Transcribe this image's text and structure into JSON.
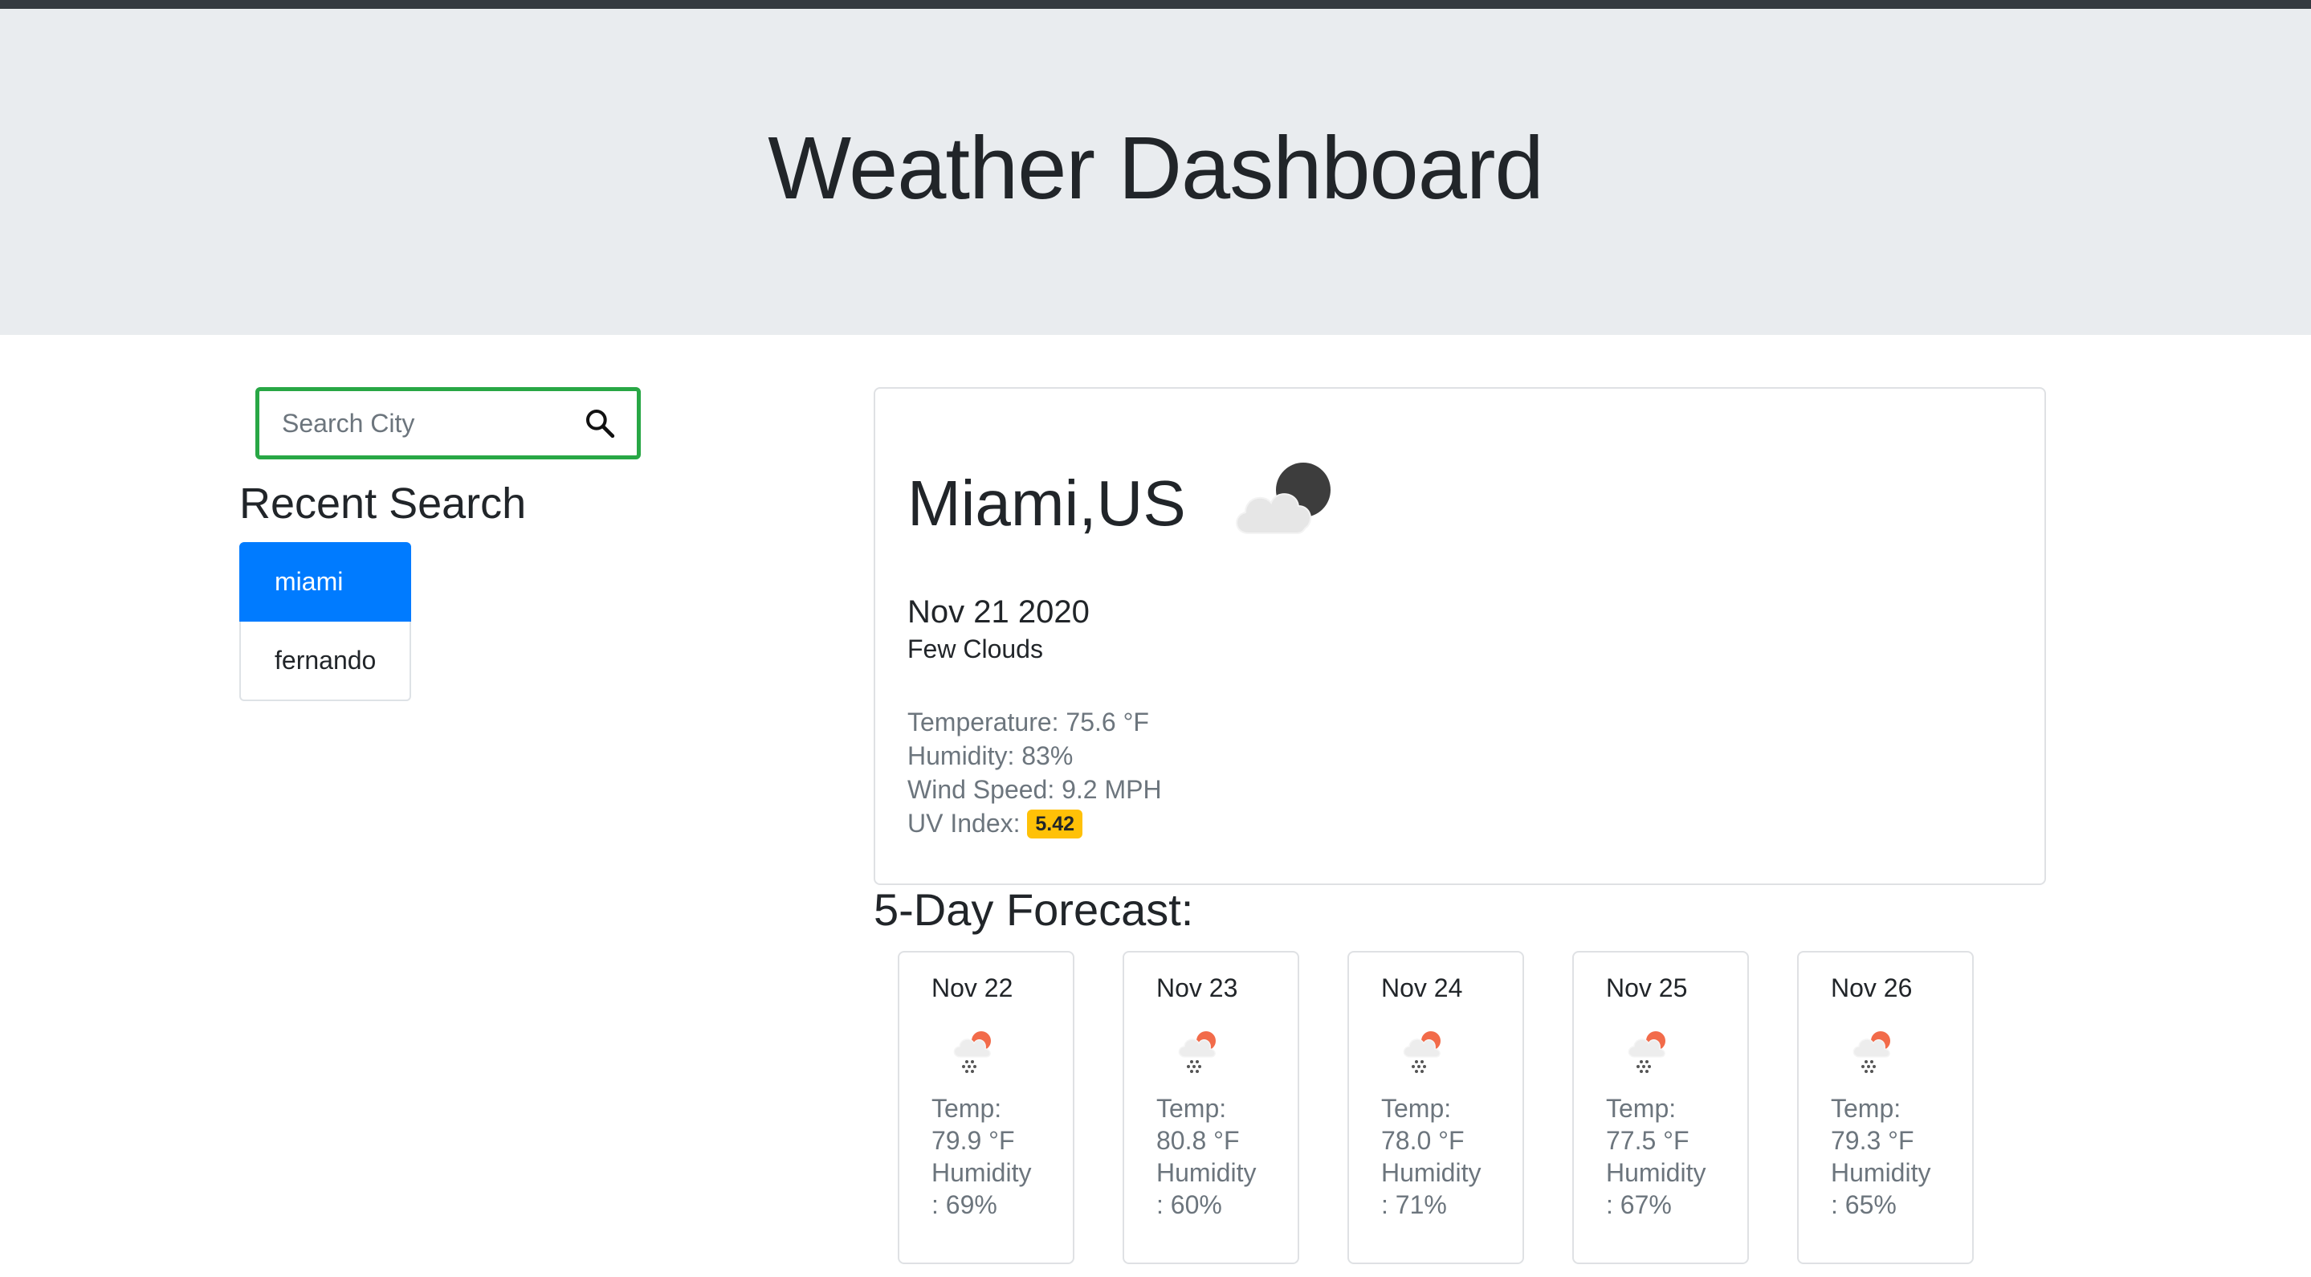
{
  "header": {
    "title": "Weather Dashboard"
  },
  "search": {
    "placeholder": "Search City",
    "value": ""
  },
  "recent": {
    "title": "Recent Search",
    "items": [
      {
        "label": "miami",
        "active": true
      },
      {
        "label": "fernando",
        "active": false
      }
    ]
  },
  "current": {
    "city": "Miami,US",
    "icon": "few-clouds-night-icon",
    "date": "Nov 21 2020",
    "description": "Few Clouds",
    "temperature": "Temperature: 75.6 °F",
    "humidity": "Humidity: 83%",
    "wind": "Wind Speed: 9.2 MPH",
    "uv_label": "UV Index:",
    "uv_value": "5.42",
    "uv_color": "#ffc107"
  },
  "forecast": {
    "title": "5-Day Forecast:",
    "days": [
      {
        "date": "Nov 22",
        "icon": "rain-sun-icon",
        "temp_label": "Temp:",
        "temp": "79.9 °F",
        "hum_label": "Humidity",
        "hum": ": 69%"
      },
      {
        "date": "Nov 23",
        "icon": "rain-sun-icon",
        "temp_label": "Temp:",
        "temp": "80.8 °F",
        "hum_label": "Humidity",
        "hum": ": 60%"
      },
      {
        "date": "Nov 24",
        "icon": "rain-sun-icon",
        "temp_label": "Temp:",
        "temp": "78.0 °F",
        "hum_label": "Humidity",
        "hum": ": 71%"
      },
      {
        "date": "Nov 25",
        "icon": "rain-sun-icon",
        "temp_label": "Temp:",
        "temp": "77.5 °F",
        "hum_label": "Humidity",
        "hum": ": 67%"
      },
      {
        "date": "Nov 26",
        "icon": "rain-sun-icon",
        "temp_label": "Temp:",
        "temp": "79.3 °F",
        "hum_label": "Humidity",
        "hum": ": 65%"
      }
    ]
  },
  "colors": {
    "accent": "#007bff",
    "search_border": "#28a745",
    "jumbotron_bg": "#e9ecef"
  }
}
